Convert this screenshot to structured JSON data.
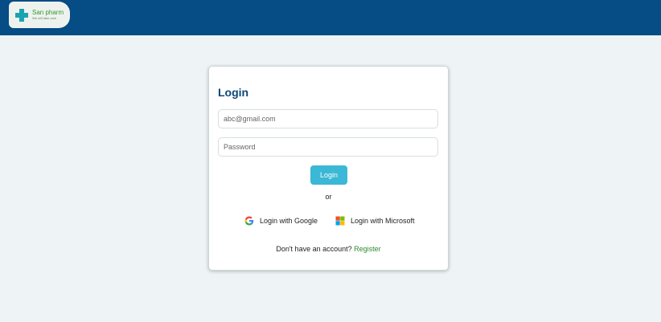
{
  "header": {
    "brand_name": "San pharm",
    "tagline": "We will take care",
    "background_color": "#064c85"
  },
  "login": {
    "title": "Login",
    "email_placeholder": "abc@gmail.com",
    "password_placeholder": "Password",
    "submit_label": "Login",
    "divider_text": "or",
    "google_label": "Login with Google",
    "microsoft_label": "Login with Microsoft",
    "signup_prompt": "Don't have an account?",
    "register_label": "Register",
    "accent_color": "#3ab8d6",
    "title_color": "#0b4777",
    "link_color": "#2e8b2e"
  },
  "icons": {
    "logo": "medical-cross-icon",
    "google": "google-icon",
    "microsoft": "microsoft-icon"
  }
}
